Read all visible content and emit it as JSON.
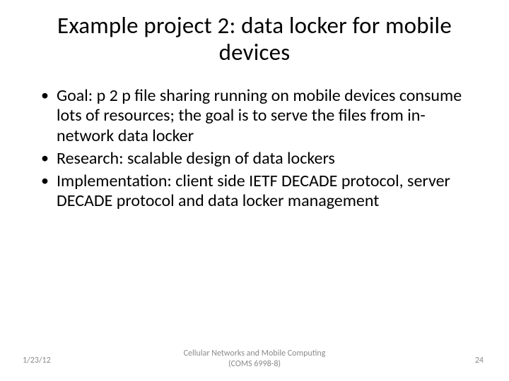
{
  "title": "Example project 2: data locker for mobile devices",
  "bullets": [
    "Goal: p 2 p file sharing running on mobile devices consume lots of resources; the goal is to serve the files from in-network data locker",
    "Research: scalable design of data lockers",
    "Implementation: client side IETF DECADE protocol, server DECADE protocol and data locker management"
  ],
  "footer": {
    "date": "1/23/12",
    "center_line1": "Cellular Networks and Mobile Computing",
    "center_line2": "(COMS 6998-8)",
    "page": "24"
  }
}
